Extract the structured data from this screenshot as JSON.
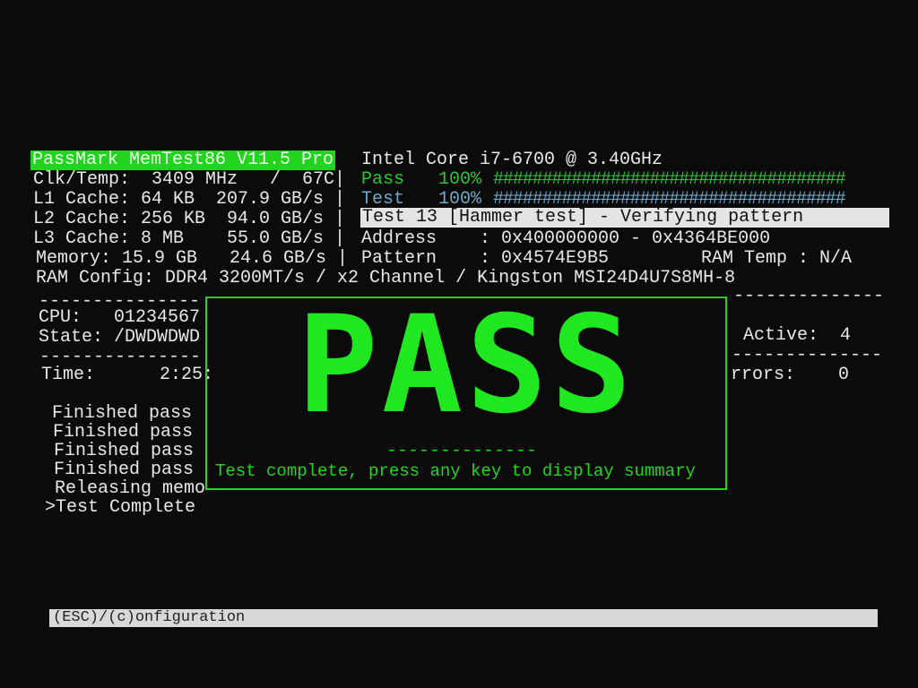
{
  "header": {
    "title": "PassMark MemTest86 V11.5 Pro",
    "cpu_name": "Intel Core i7-6700 @ 3.40GHz"
  },
  "sysinfo": [
    "Clk/Temp:  3409 MHz   /  67C|",
    "L1 Cache: 64 KB  207.9 GB/s |",
    "L2 Cache: 256 KB  94.0 GB/s |",
    "L3 Cache: 8 MB    55.0 GB/s |",
    "Memory: 15.9 GB   24.6 GB/s |",
    "RAM Config: DDR4 3200MT/s / x2 Channel / Kingston MSI24D4U7S8MH-8"
  ],
  "progress": {
    "pass_label": "Pass",
    "pass_pct": "100%",
    "pass_value": 100,
    "test_label": "Test",
    "test_pct": "100%",
    "test_value": 100,
    "bar": "####################################"
  },
  "current_test": "Test 13 [Hammer test] - Verifying pattern",
  "address": "Address    : 0x400000000 - 0x4364BE000",
  "pattern": "Pattern    : 0x4574E9B5",
  "ram_temp": "RAM Temp : N/A",
  "left_panel": {
    "divider": "---------------",
    "cpu": "CPU:   01234567",
    "state": "State: /DWDWDWD",
    "time": "Time:      2:25:",
    "log": [
      "Finished pass",
      "Finished pass",
      "Finished pass",
      "Finished pass",
      "Releasing memo",
      ">Test Complete"
    ]
  },
  "right_panel": {
    "divider": "--------------",
    "active": "Active:  4",
    "errors": "rrors:    0"
  },
  "dialog": {
    "big_text": "PASS",
    "divider": "--------------",
    "message": "Test complete, press any key to display summary"
  },
  "footer": {
    "hint": "(ESC)/(c)onfiguration"
  },
  "colors": {
    "accent": "#22d41e",
    "pass": "#2fc23a",
    "test": "#6fa8c8"
  }
}
